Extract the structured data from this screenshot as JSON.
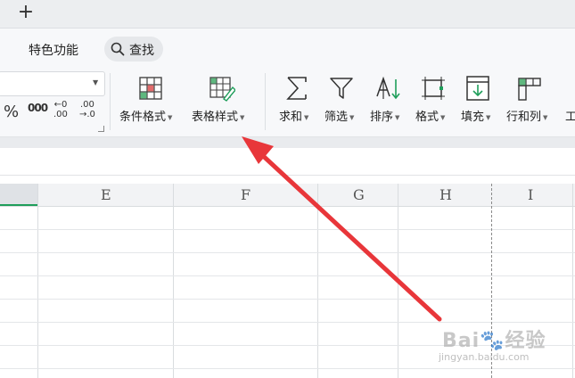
{
  "tabbar": {
    "new_tab": "+"
  },
  "menu": {
    "special_features": "特色功能",
    "search_label": "查找"
  },
  "number_format": {
    "percent": "%",
    "thousands": "000",
    "decimal_increase_top": "←0",
    "decimal_increase_bottom": ".00",
    "decimal_decrease_top": ".00",
    "decimal_decrease_bottom": "→.0"
  },
  "ribbon": {
    "conditional_format": "条件格式",
    "table_style": "表格样式",
    "sum": "求和",
    "filter": "筛选",
    "sort": "排序",
    "format": "格式",
    "fill": "填充",
    "rows_cols": "行和列",
    "worksheet_partial": "工"
  },
  "columns": [
    "E",
    "F",
    "G",
    "H",
    "I"
  ],
  "watermark": {
    "logo": "Bai🐾经验",
    "site": "jingyan.baidu.com"
  },
  "colors": {
    "accent_green": "#1e9e5a",
    "arrow_red": "#e8363a",
    "tab_bar": "#eceef0",
    "ribbon_bg": "#f7f8fa"
  },
  "icons": {
    "conditional_format": "conditional-format-grid-icon",
    "table_style": "table-style-brush-icon",
    "sum": "sigma-icon",
    "filter": "funnel-icon",
    "sort": "sort-az-arrow-icon",
    "format": "format-frame-icon",
    "fill": "fill-down-icon",
    "rows_cols": "rows-cols-icon"
  }
}
